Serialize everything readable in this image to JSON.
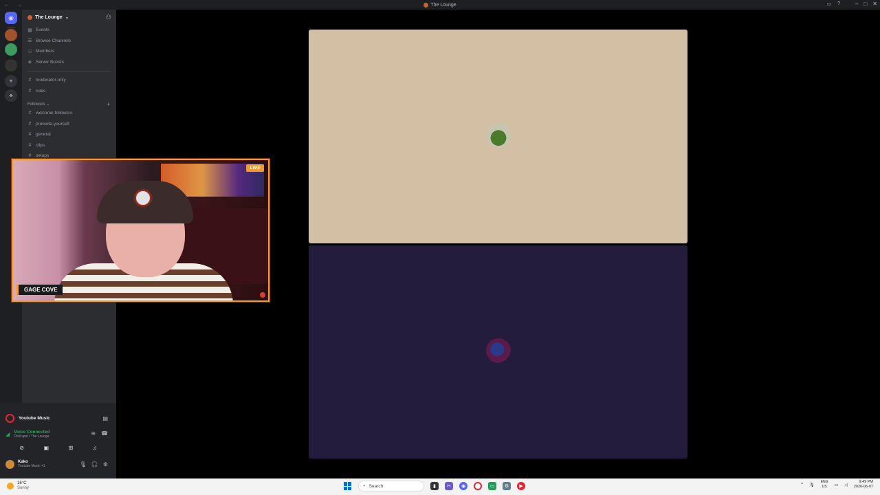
{
  "window": {
    "title": "The Lounge",
    "nav_arrows": "← →",
    "minimize": "–",
    "maximize": "□",
    "close": "✕",
    "inbox_icon": "inbox-icon",
    "help_icon": "help-icon"
  },
  "server_rail": {
    "home_icon": "discord-home-icon",
    "add_server": "+",
    "explore": "⌖"
  },
  "sidebar": {
    "server_name": "The Lounge",
    "server_chevron": "⌄",
    "top_items": [
      {
        "icon": "▦",
        "label": "Events"
      },
      {
        "icon": "☰",
        "label": "Browse Channels"
      },
      {
        "icon": "👥",
        "label": "Members"
      },
      {
        "icon": "◈",
        "label": "Server Boosts"
      }
    ],
    "channels": [
      {
        "icon": "#",
        "label": "moderator-only"
      },
      {
        "icon": "#",
        "label": "rules"
      }
    ],
    "category": {
      "label": "Followers ⌄",
      "plus": "+"
    },
    "category_channels": [
      {
        "icon": "#",
        "label": "welcome-followers"
      },
      {
        "icon": "#",
        "label": "promote-yourself"
      },
      {
        "icon": "#",
        "label": "general"
      },
      {
        "icon": "#",
        "label": "clips"
      },
      {
        "icon": "#",
        "label": "setups"
      }
    ]
  },
  "user_panel": {
    "activity": {
      "label": "Youtube Music"
    },
    "voice": {
      "status": "Voice Connected",
      "channel": "Chill spot / The Lounge"
    },
    "account": {
      "name": "Kako",
      "status": "Youtube Music +1"
    }
  },
  "webcam": {
    "live_badge": "LIVE",
    "streamer_name": "GAGE COVE"
  },
  "taskbar": {
    "weather": {
      "temp": "16°C",
      "condition": "Sunny"
    },
    "search_placeholder": "Search",
    "tray": {
      "lang_top": "ENG",
      "lang_bottom": "US",
      "time": "9:49 PM",
      "date": "2026-06-07"
    }
  },
  "colors": {
    "accent_orange": "#f09a30",
    "tile_1_bg": "#d2bfa4",
    "tile_2_bg": "#231c3d",
    "voice_green": "#23a55a"
  }
}
